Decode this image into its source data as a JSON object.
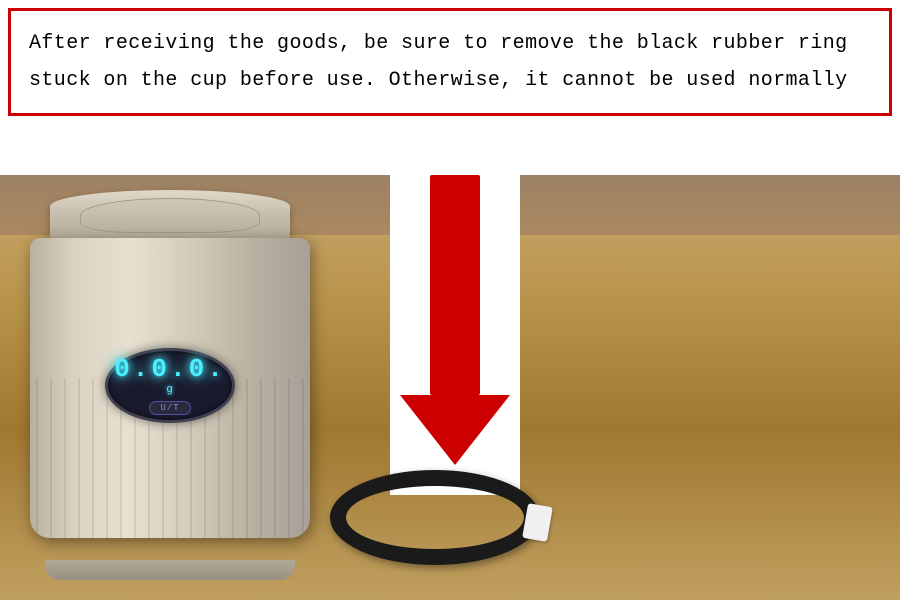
{
  "notice": {
    "text": "After receiving the goods, be sure to remove the black rubber ring stuck on the cup before use. Otherwise, it cannot be used normally",
    "border_color": "#cc0000"
  },
  "display": {
    "digits": "0.0.0.",
    "unit": "g",
    "button_label": "U/T"
  },
  "image": {
    "description": "Coffee scale cup with digital display and black rubber ring on wooden table",
    "arrow_color": "#cc0000",
    "white_bg": "#ffffff"
  }
}
